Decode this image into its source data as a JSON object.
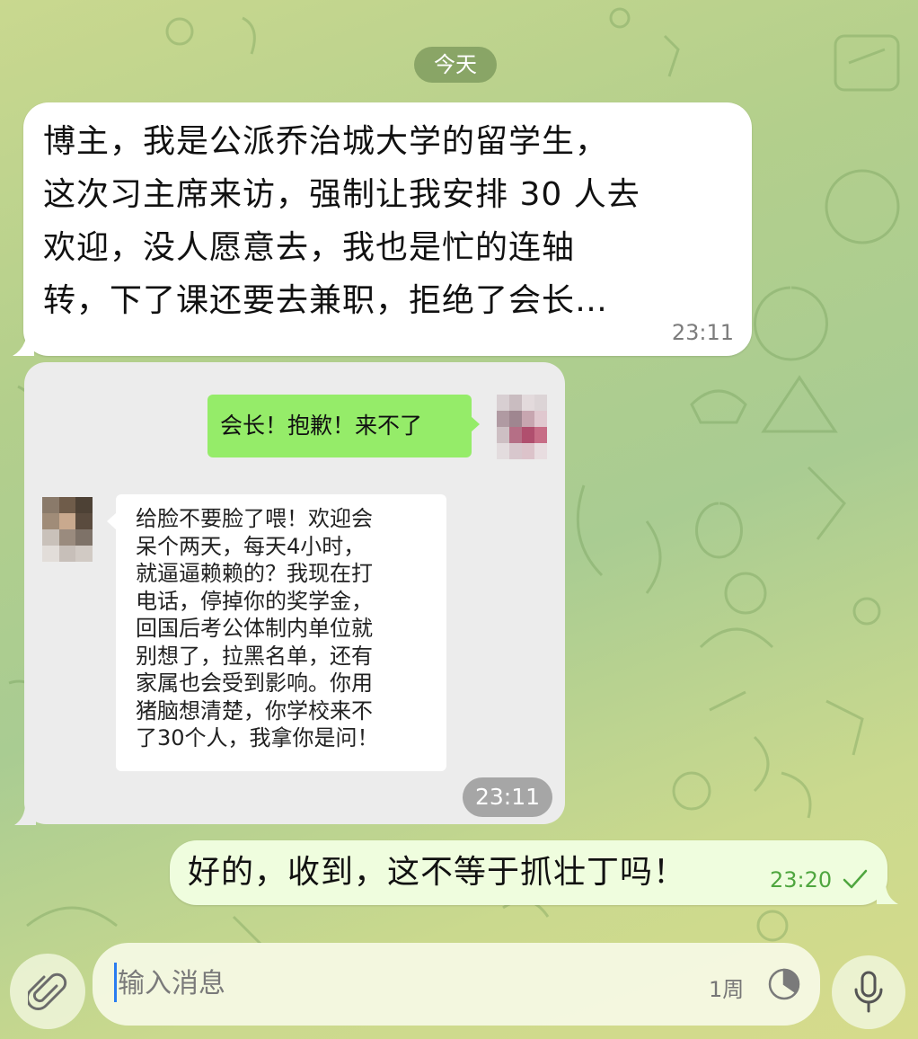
{
  "date_separator": "今天",
  "incoming_message": {
    "lines": [
      "博主，我是公派乔治城大学的留学生，",
      "这次习主席来访，强制让我安排 30 人去",
      "欢迎，没人愿意去，我也是忙的连轴",
      "转，下了课还要去兼职，拒绝了会长…"
    ],
    "time": "23:11"
  },
  "forwarded_screenshot": {
    "sent_message": "会长！抱歉！来不了",
    "reply_lines": [
      "给脸不要脸了喂！欢迎会",
      "呆个两天，每天4小时，",
      "就逼逼赖赖的？我现在打",
      "电话，停掉你的奖学金，",
      "回国后考公体制内单位就",
      "别想了，拉黑名单，还有",
      "家属也会受到影响。你用",
      "猪脑想清楚，你学校来不",
      "了30个人，我拿你是问！"
    ],
    "time": "23:11"
  },
  "outgoing_message": {
    "text": "好的，收到，这不等于抓壮丁吗！",
    "time": "23:20",
    "status_icon": "check-icon"
  },
  "composer": {
    "placeholder": "输入消息",
    "timer_label": "1周",
    "attach_icon": "paperclip-icon",
    "timer_icon": "timer-icon",
    "mic_icon": "microphone-icon"
  },
  "colors": {
    "incoming_bubble": "#ffffff",
    "outgoing_bubble": "#effdde",
    "wechat_green": "#95ec69",
    "time_green": "#4fa63f"
  }
}
